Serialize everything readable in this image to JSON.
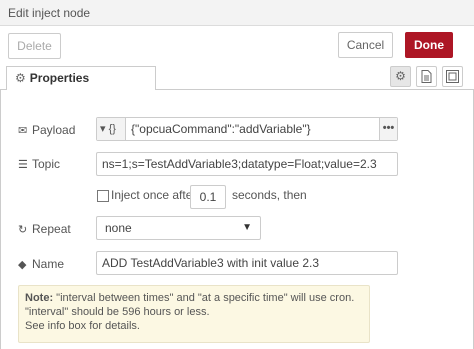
{
  "window": {
    "title": "Edit inject node"
  },
  "toolbar": {
    "delete_label": "Delete",
    "cancel_label": "Cancel",
    "done_label": "Done"
  },
  "tabs": {
    "properties_label": "Properties"
  },
  "form": {
    "payload": {
      "label": "Payload",
      "type_symbol": "{}",
      "value": "{\"opcuaCommand\":\"addVariable\"}",
      "more_symbol": "•••"
    },
    "topic": {
      "label": "Topic",
      "value": "ns=1;s=TestAddVariable3;datatype=Float;value=2.3"
    },
    "inject_once": {
      "label": "Inject once after",
      "checked": false,
      "delay": "0.1",
      "suffix": "seconds, then"
    },
    "repeat": {
      "label": "Repeat",
      "selected": "none"
    },
    "name": {
      "label": "Name",
      "value": "ADD TestAddVariable3 with init value 2.3"
    }
  },
  "note": {
    "prefix": "Note:",
    "line1": " \"interval between times\" and \"at a specific time\" will use cron.",
    "line2": "\"interval\" should be 596 hours or less.",
    "line3": "See info box for details."
  }
}
